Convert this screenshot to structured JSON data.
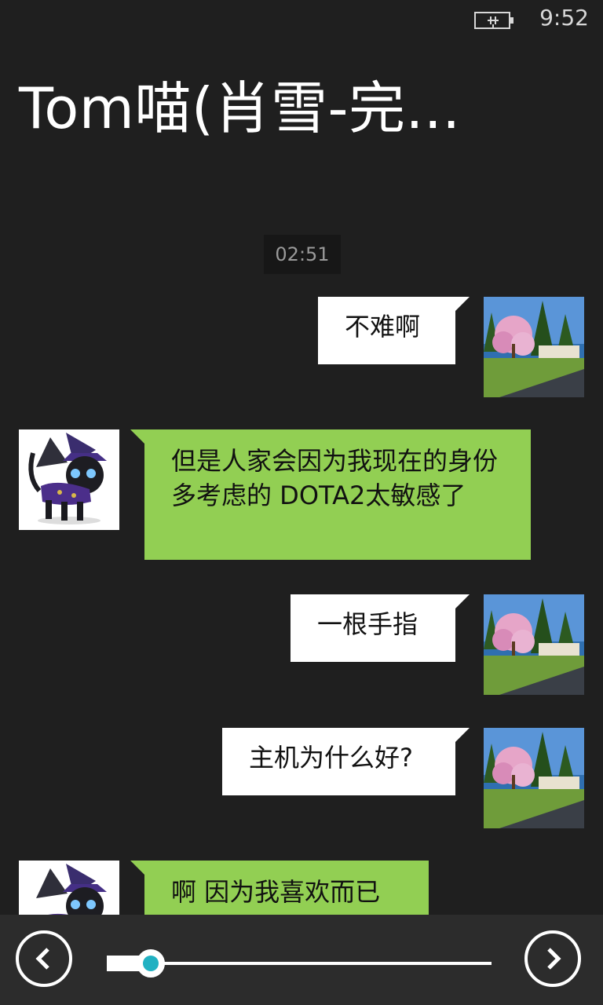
{
  "status": {
    "time": "9:52",
    "battery_icon": "battery-charging-icon"
  },
  "header": {
    "title": "Tom喵(肖雪-完..."
  },
  "chat": {
    "timestamp": "02:51",
    "messages": [
      {
        "from": "me",
        "text": "不难啊"
      },
      {
        "from": "contact",
        "text": "但是人家会因为我现在的身份 多考虑的 DOTA2太敏感了"
      },
      {
        "from": "me",
        "text": "一根手指"
      },
      {
        "from": "me",
        "text": "主机为什么好?"
      },
      {
        "from": "contact",
        "text": "啊 因为我喜欢而已"
      }
    ],
    "colors": {
      "incoming_bubble": "#92cf53",
      "outgoing_bubble": "#ffffff",
      "background": "#1f1f1f"
    }
  },
  "toolbar": {
    "prev_icon": "chevron-left-icon",
    "next_icon": "chevron-right-icon",
    "slider_fraction": 0.115,
    "accent": "#21b1c2"
  }
}
